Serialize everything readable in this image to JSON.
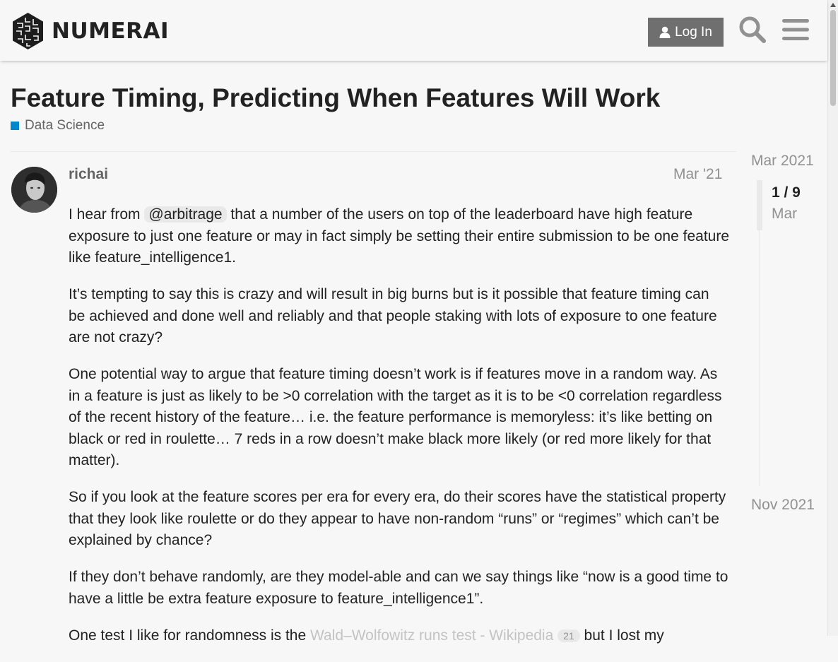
{
  "header": {
    "logo_text": "NUMERAI",
    "login_label": "Log In",
    "search_icon": "search-icon",
    "menu_icon": "hamburger-menu-icon"
  },
  "topic": {
    "title": "Feature Timing, Predicting When Features Will Work",
    "category": "Data Science",
    "category_color": "#0088cc"
  },
  "post": {
    "author": "richai",
    "date": "Mar '21",
    "p1": {
      "before": "I hear from ",
      "mention": "@arbitrage",
      "after": " that a number of the users on top of the leaderboard have high feature exposure to just one feature or may in fact simply be setting their entire submission to be one feature like feature_intelligence1."
    },
    "p2": "It’s tempting to say this is crazy and will result in big burns but is it possible that feature timing can be achieved and done well and reliably and that people staking with lots of exposure to one feature are not crazy?",
    "p3": "One potential way to argue that feature timing doesn’t work is if features move in a random way. As in a feature is just as likely to be >0 correlation with the target as it is to be <0 correlation regardless of the recent history of the feature… i.e. the feature performance is memoryless: it’s like betting on black or red in roulette… 7 reds in a row doesn’t make black more likely (or red more likely for that matter).",
    "p4": "So if you look at the feature scores per era for every era, do their scores have the statistical property that they look like roulette or do they appear to have non-random “runs” or “regimes” which can’t be explained by chance?",
    "p5": "If they don’t behave randomly, are they model-able and can we say things like “now is a good time to have a little be extra feature exposure to feature_intelligence1”.",
    "p6": {
      "before": "One test I like for randomness is the ",
      "link": "Wald–Wolfowitz runs test - Wikipedia",
      "clicks": "21",
      "after": " but I lost my"
    }
  },
  "timeline": {
    "start": "Mar 2021",
    "position": "1 / 9",
    "position_date": "Mar",
    "end": "Nov 2021"
  }
}
